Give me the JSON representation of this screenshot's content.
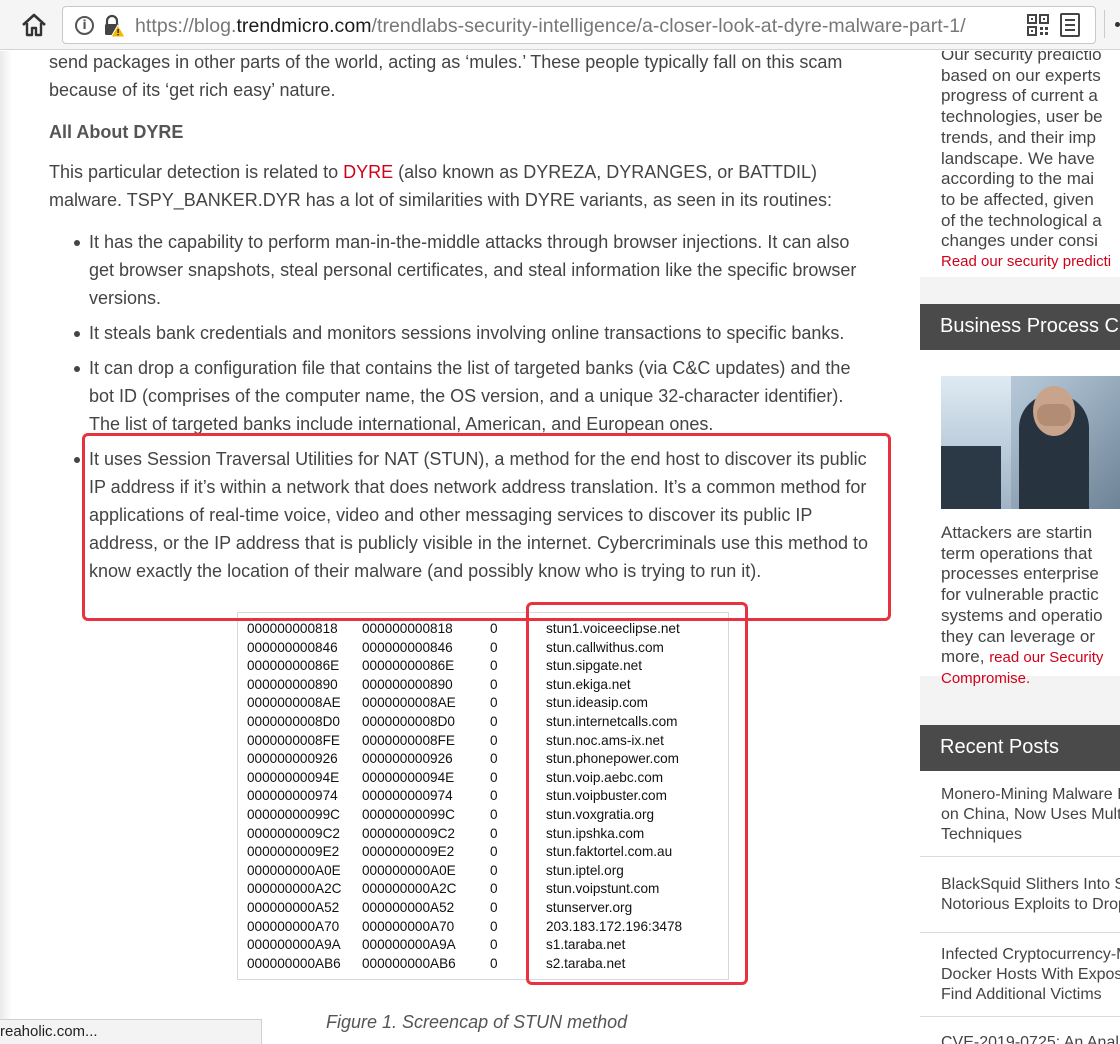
{
  "browser": {
    "url_prefix": "https://blog.",
    "url_host": "trendmicro.com",
    "url_path": "/trendlabs-security-intelligence/a-closer-look-at-dyre-malware-part-1/",
    "status_text": "reaholic.com..."
  },
  "article": {
    "intro_paragraph": "send packages in other parts of the world, acting as ‘mules.’  These people typically fall on this scam because of its ‘get rich easy’ nature.",
    "section_heading": "All About DYRE",
    "detection_before": "This particular detection is related to ",
    "detection_link": "DYRE",
    "detection_after": " (also known as DYREZA, DYRANGES, or BATTDIL) malware. TSPY_BANKER.DYR has a lot of similarities with DYRE variants, as seen in its routines:",
    "bullets": [
      "It has the capability to perform man-in-the-middle attacks through browser injections. It can also get browser snapshots, steal personal certificates, and steal information like the specific browser versions.",
      "It steals bank credentials and monitors sessions involving online transactions to specific banks.",
      "It can drop a configuration file that contains the list of targeted banks (via C&C updates) and the bot ID (comprises of the computer name, the OS version, and a unique 32-character identifier). The list of targeted banks include international, American, and European ones.",
      "It uses Session Traversal Utilities for NAT (STUN), a method for the end host to discover its public IP address if it’s within a network that does network address translation. It’s a common method for applications of real-time voice, video and other messaging services to discover its public IP address, or the IP address that is publicly visible in the internet. Cybercriminals use this method to know exactly the location of their malware (and possibly know who is trying to run it)."
    ],
    "figure_caption": "Figure 1. Screencap of STUN method",
    "highlight_color": "#e8323f",
    "link_color": "#d0021b"
  },
  "stun_rows": [
    [
      "000000000818",
      "000000000818",
      "0",
      "stun1.voiceeclipse.net"
    ],
    [
      "000000000846",
      "000000000846",
      "0",
      "stun.callwithus.com"
    ],
    [
      "00000000086E",
      "00000000086E",
      "0",
      "stun.sipgate.net"
    ],
    [
      "000000000890",
      "000000000890",
      "0",
      "stun.ekiga.net"
    ],
    [
      "0000000008AE",
      "0000000008AE",
      "0",
      "stun.ideasip.com"
    ],
    [
      "0000000008D0",
      "0000000008D0",
      "0",
      "stun.internetcalls.com"
    ],
    [
      "0000000008FE",
      "0000000008FE",
      "0",
      "stun.noc.ams-ix.net"
    ],
    [
      "000000000926",
      "000000000926",
      "0",
      "stun.phonepower.com"
    ],
    [
      "00000000094E",
      "00000000094E",
      "0",
      "stun.voip.aebc.com"
    ],
    [
      "000000000974",
      "000000000974",
      "0",
      "stun.voipbuster.com"
    ],
    [
      "00000000099C",
      "00000000099C",
      "0",
      "stun.voxgratia.org"
    ],
    [
      "0000000009C2",
      "0000000009C2",
      "0",
      "stun.ipshka.com"
    ],
    [
      "0000000009E2",
      "0000000009E2",
      "0",
      "stun.faktortel.com.au"
    ],
    [
      "000000000A0E",
      "000000000A0E",
      "0",
      "stun.iptel.org"
    ],
    [
      "000000000A2C",
      "000000000A2C",
      "0",
      "stun.voipstunt.com"
    ],
    [
      "000000000A52",
      "000000000A52",
      "0",
      "stunserver.org"
    ],
    [
      "000000000A70",
      "000000000A70",
      "0",
      "203.183.172.196:3478"
    ],
    [
      "000000000A9A",
      "000000000A9A",
      "0",
      "s1.taraba.net"
    ],
    [
      "000000000AB6",
      "000000000AB6",
      "0",
      "s2.taraba.net"
    ]
  ],
  "sidebar": {
    "predictions_lines": [
      "Our security predictio",
      "based on our experts",
      "progress of current a",
      "technologies, user be",
      "trends, and their imp",
      "landscape. We have",
      "according to the mai",
      "to be affected, given",
      "of the technological a",
      "changes under consi"
    ],
    "predictions_link": "Read our security predicti",
    "bpc_header": "Business Process C",
    "bpc_lines": [
      "Attackers are startin",
      "term operations that",
      "processes enterprise",
      "for vulnerable practic",
      "systems and operatio",
      "they can leverage or"
    ],
    "bpc_more": "more, ",
    "bpc_link_1": "read our Security",
    "bpc_link_2": "Compromise.",
    "recent_header": "Recent Posts",
    "recent_posts": [
      [
        "Monero-Mining Malware I",
        "on China, Now Uses Mult",
        "Techniques"
      ],
      [
        "BlackSquid Slithers Into S",
        "Notorious Exploits to Drop"
      ],
      [
        "Infected Cryptocurrency-M",
        "Docker Hosts With Expos",
        "Find Additional Victims"
      ],
      [
        "CVE-2019-0725: An Anal"
      ]
    ]
  }
}
